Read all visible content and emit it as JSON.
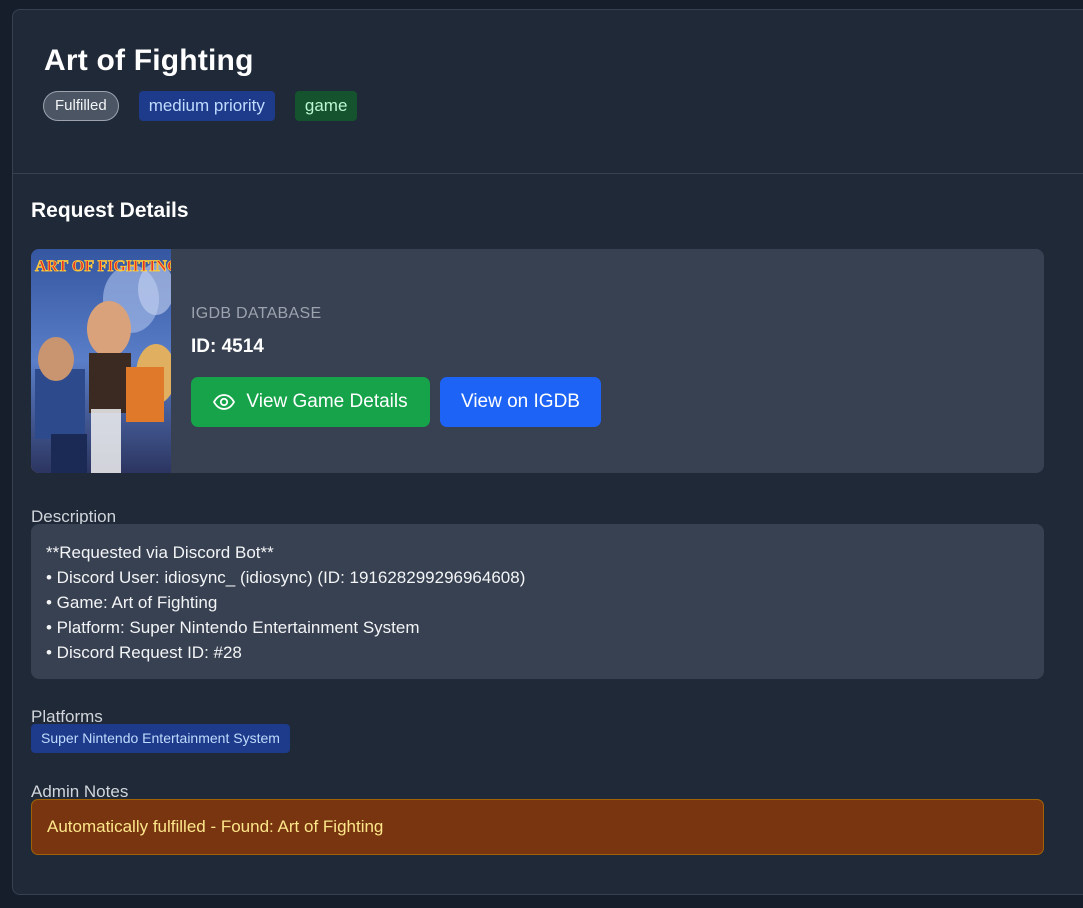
{
  "request": {
    "title": "Art of Fighting",
    "status": "Fulfilled",
    "priority": "medium priority",
    "type": "game"
  },
  "details": {
    "section_title": "Request Details",
    "igdb": {
      "source_label": "IGDB DATABASE",
      "id_text": "ID: 4514",
      "view_details_label": "View Game Details",
      "view_igdb_label": "View on IGDB",
      "cover_logo_text": "ART OF FIGHTING"
    },
    "description_label": "Description",
    "description_lines": [
      "**Requested via Discord Bot**",
      "• Discord User: idiosync_ (idiosync) (ID: 191628299296964608)",
      "• Game: Art of Fighting",
      "• Platform: Super Nintendo Entertainment System",
      "• Discord Request ID: #28"
    ],
    "platforms_label": "Platforms",
    "platforms": [
      "Super Nintendo Entertainment System"
    ],
    "admin_notes_label": "Admin Notes",
    "admin_notes": "Automatically fulfilled - Found: Art of Fighting"
  },
  "colors": {
    "background": "#161e2c",
    "card": "#1f2937",
    "panel": "#374151",
    "green_button": "#16a34a",
    "blue_button": "#1d63f5",
    "priority_badge": "#1e3a8a",
    "type_badge": "#14532d",
    "notes_bg": "#78350f"
  },
  "icons": {
    "view_details": "eye-icon"
  }
}
